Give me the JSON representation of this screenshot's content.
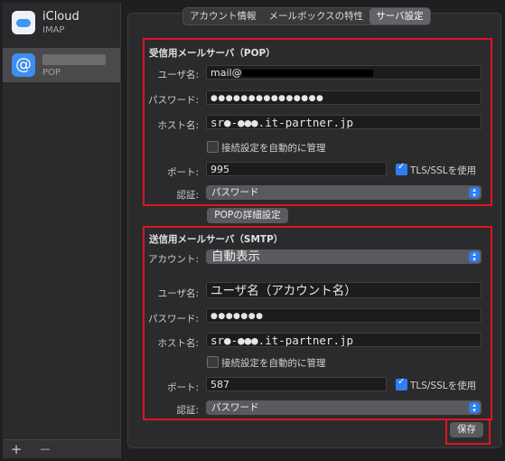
{
  "sidebar": {
    "accounts": [
      {
        "name": "iCloud",
        "type": "IMAP",
        "selected": false
      },
      {
        "name": "",
        "type": "POP",
        "selected": true
      }
    ],
    "add_label": "+",
    "remove_label": "—"
  },
  "tabs": [
    {
      "label": "アカウント情報",
      "active": false
    },
    {
      "label": "メールボックスの特性",
      "active": false
    },
    {
      "label": "サーバ設定",
      "active": true
    }
  ],
  "incoming": {
    "title": "受信用メールサーバ（POP）",
    "username_label": "ユーザ名:",
    "username_value": "mail@",
    "password_label": "パスワード:",
    "password_value": "●●●●●●●●●●●●●●●",
    "hostname_label": "ホスト名:",
    "hostname_value": "sr●-●●●.it-partner.jp",
    "auto_manage_label": "接続設定を自動的に管理",
    "auto_manage_checked": false,
    "port_label": "ポート:",
    "port_value": "995",
    "tls_label": "TLS/SSLを使用",
    "tls_checked": true,
    "auth_label": "認証:",
    "auth_value": "パスワード",
    "advanced_button": "POPの詳細設定"
  },
  "outgoing": {
    "title": "送信用メールサーバ（SMTP）",
    "account_label": "アカウント:",
    "account_value": "自動表示",
    "username_label": "ユーザ名:",
    "username_value": "ユーザ名（アカウント名）",
    "password_label": "パスワード:",
    "password_value": "●●●●●●●",
    "hostname_label": "ホスト名:",
    "hostname_value": "sr●-●●●.it-partner.jp",
    "auto_manage_label": "接続設定を自動的に管理",
    "auto_manage_checked": false,
    "port_label": "ポート:",
    "port_value": "587",
    "tls_label": "TLS/SSLを使用",
    "tls_checked": true,
    "auth_label": "認証:",
    "auth_value": "パスワード"
  },
  "save_button": "保存",
  "colors": {
    "highlight": "#e0141e",
    "accent": "#2f7ef2"
  }
}
